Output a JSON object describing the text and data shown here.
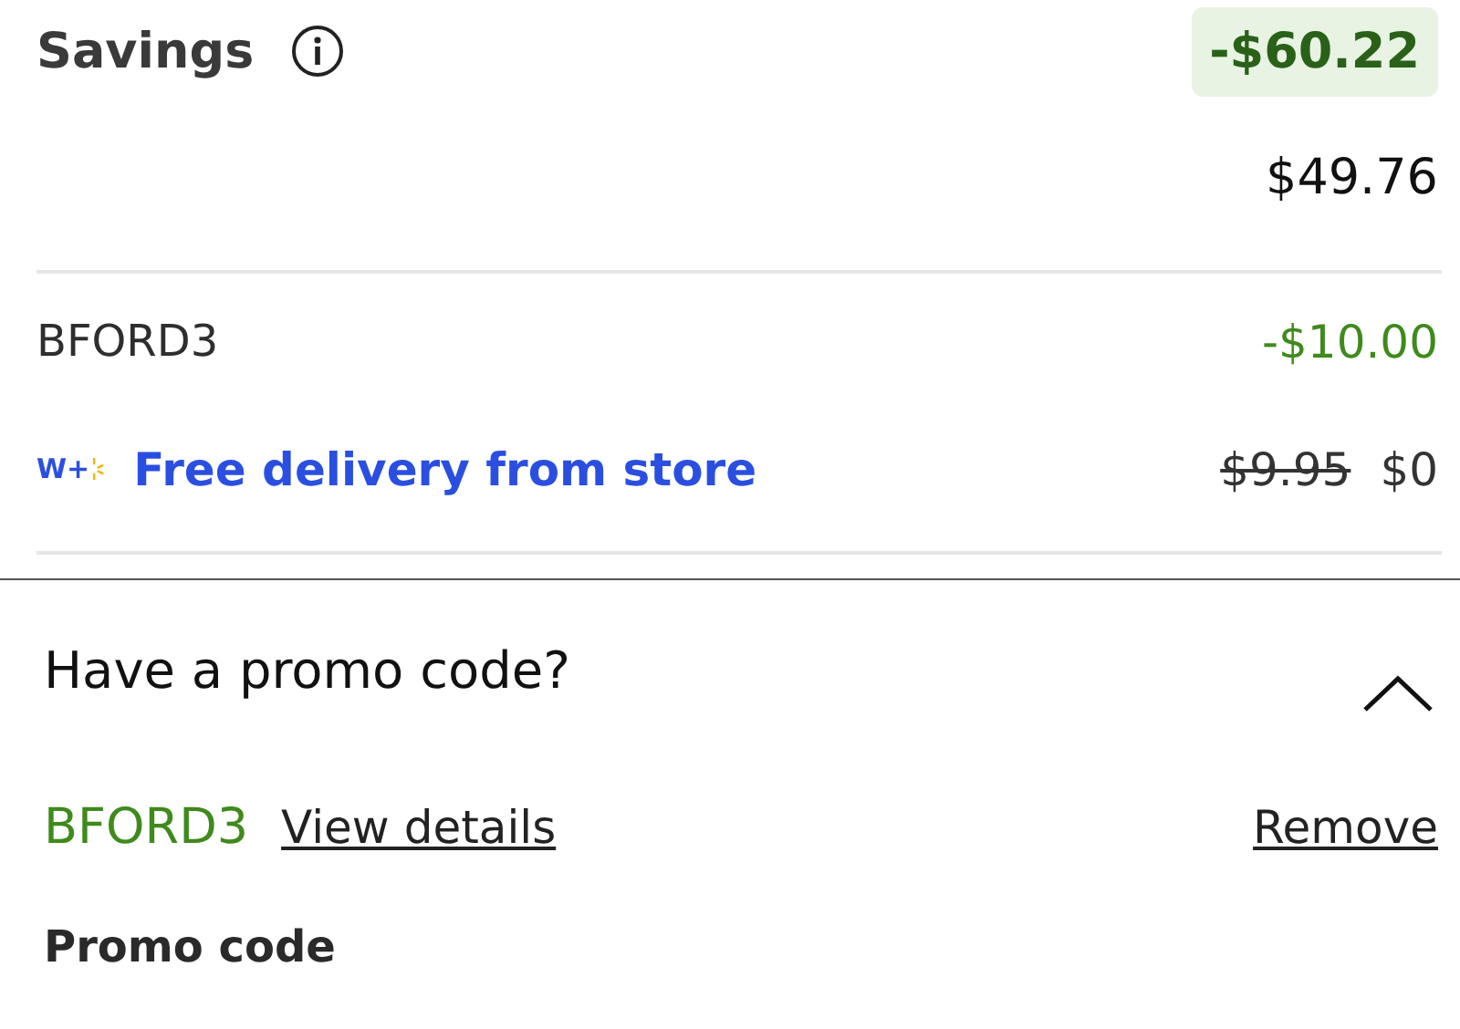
{
  "savings": {
    "label": "Savings",
    "amount": "-$60.22",
    "subtotal": "$49.76"
  },
  "lines": [
    {
      "kind": "promo",
      "label": "BFORD3",
      "amount": "-$10.00"
    },
    {
      "kind": "delivery",
      "badge": "W+",
      "label": "Free delivery from store",
      "old_price": "$9.95",
      "amount": "$0"
    }
  ],
  "promo_section": {
    "title": "Have a promo code?",
    "expanded": true,
    "applied_code": "BFORD3",
    "details_link": "View details",
    "remove_link": "Remove",
    "field_label": "Promo code"
  }
}
